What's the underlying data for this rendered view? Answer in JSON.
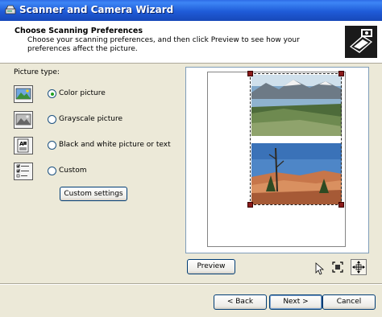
{
  "window": {
    "title": "Scanner and Camera Wizard"
  },
  "header": {
    "title": "Choose Scanning Preferences",
    "subtitle": "Choose your scanning preferences, and then click Preview to see how your preferences affect the picture."
  },
  "picture_type": {
    "label": "Picture type:",
    "options": [
      {
        "label": "Color picture",
        "selected": true,
        "icon": "color-picture-icon"
      },
      {
        "label": "Grayscale picture",
        "selected": false,
        "icon": "grayscale-picture-icon"
      },
      {
        "label": "Black and white picture or text",
        "selected": false,
        "icon": "black-white-text-icon"
      },
      {
        "label": "Custom",
        "selected": false,
        "icon": "custom-settings-icon"
      }
    ],
    "custom_settings_label": "Custom settings"
  },
  "preview": {
    "preview_label": "Preview",
    "zoom_icon": "fit-selection-icon",
    "enlarge_icon": "enlarge-preview-icon"
  },
  "footer": {
    "back_label": "< Back",
    "next_label": "Next >",
    "cancel_label": "Cancel"
  },
  "colors": {
    "titlebar": "#1F5BD8",
    "dialog_bg": "#ECE9D8",
    "handle": "#8B1A1A"
  }
}
